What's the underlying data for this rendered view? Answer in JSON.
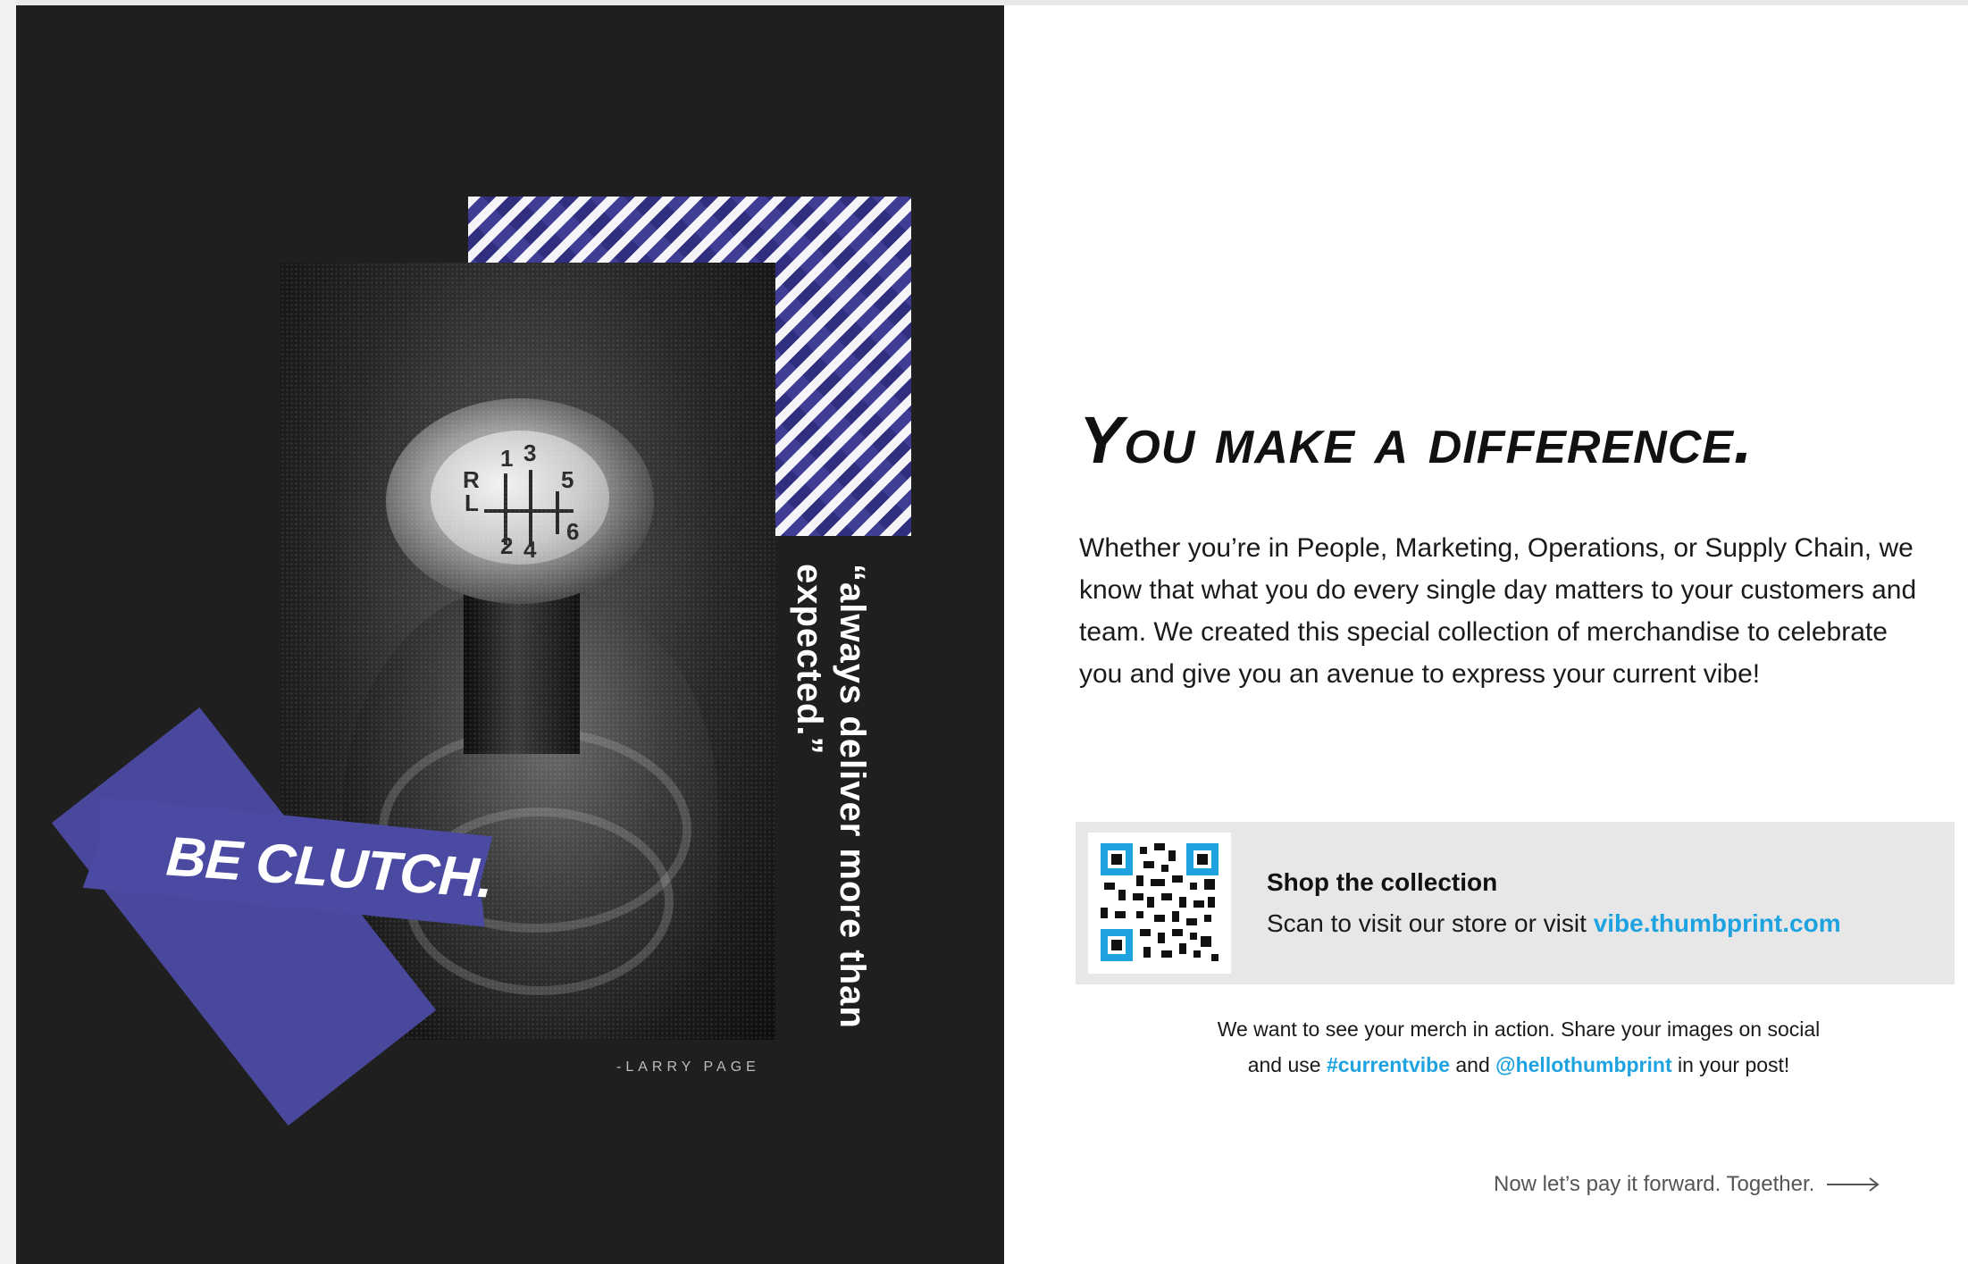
{
  "left": {
    "tape_label": "BE CLUTCH.",
    "quote": "“always deliver more than expected.”",
    "attribution": "-LARRY PAGE",
    "shifter_gears": [
      "1",
      "3",
      "5",
      "R",
      "L",
      "6",
      "2",
      "4"
    ]
  },
  "right": {
    "headline": "You make a difference.",
    "body": "Whether you’re in People, Marketing, Operations, or Supply Chain, we know that what you do every single day matters to your customers and team. We created this special collection of merchandise to celebrate you and give you an avenue to express your current vibe!",
    "shop": {
      "title": "Shop the collection",
      "scan_text": "Scan to visit our store or visit ",
      "url": "vibe.thumbprint.com"
    },
    "share": {
      "line1": "We want to see your merch in action. Share your images on social",
      "line2_prefix": "and use ",
      "hashtag": "#currentvibe",
      "and": " and ",
      "handle": "@hellothumbprint",
      "suffix": " in your post!"
    },
    "forward_text": "Now let’s pay it forward. Together."
  },
  "colors": {
    "dark_bg": "#1f1f1f",
    "tape_purple": "#4b4aa2",
    "pattern_purple": "#3f3e94",
    "link_blue": "#1fa3e0",
    "shop_box_bg": "#e7e7e7"
  }
}
